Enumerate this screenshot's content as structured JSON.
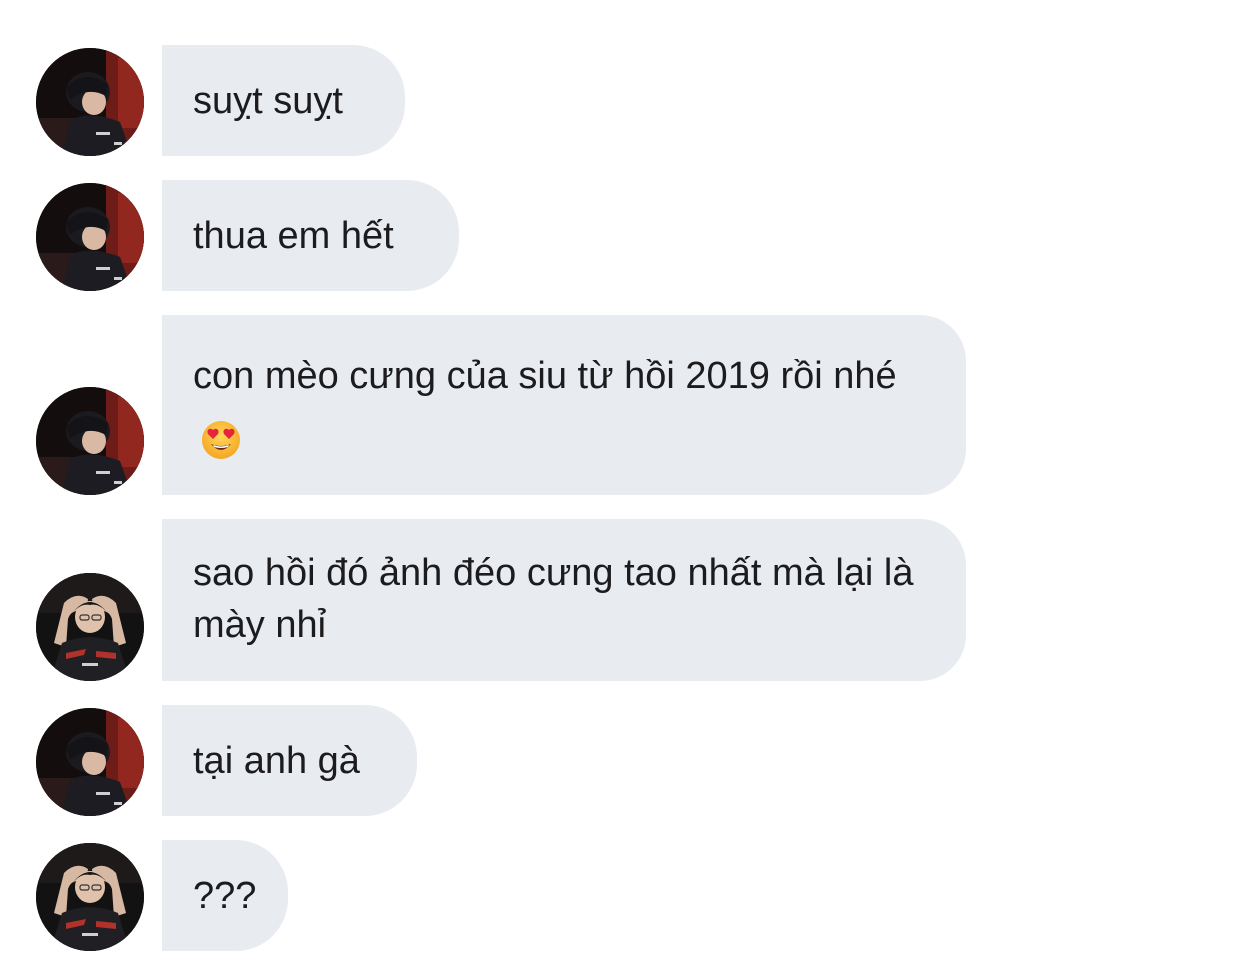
{
  "messages": [
    {
      "sender": "player-a",
      "text": "suỵt suỵt"
    },
    {
      "sender": "player-a",
      "text": "thua em hết"
    },
    {
      "sender": "player-a",
      "text": "con mèo cưng của siu từ hồi 2019 rồi nhé",
      "emoji": "heart-eyes-emoji"
    },
    {
      "sender": "player-b",
      "text": "sao hồi đó ảnh đéo cưng tao nhất mà lại là mày nhỉ"
    },
    {
      "sender": "player-a",
      "text": "tại anh gà"
    },
    {
      "sender": "player-b",
      "text": "???"
    }
  ],
  "colors": {
    "bubble_bg": "#e8ebf0",
    "text": "#1c1c1e",
    "background": "#ffffff"
  }
}
